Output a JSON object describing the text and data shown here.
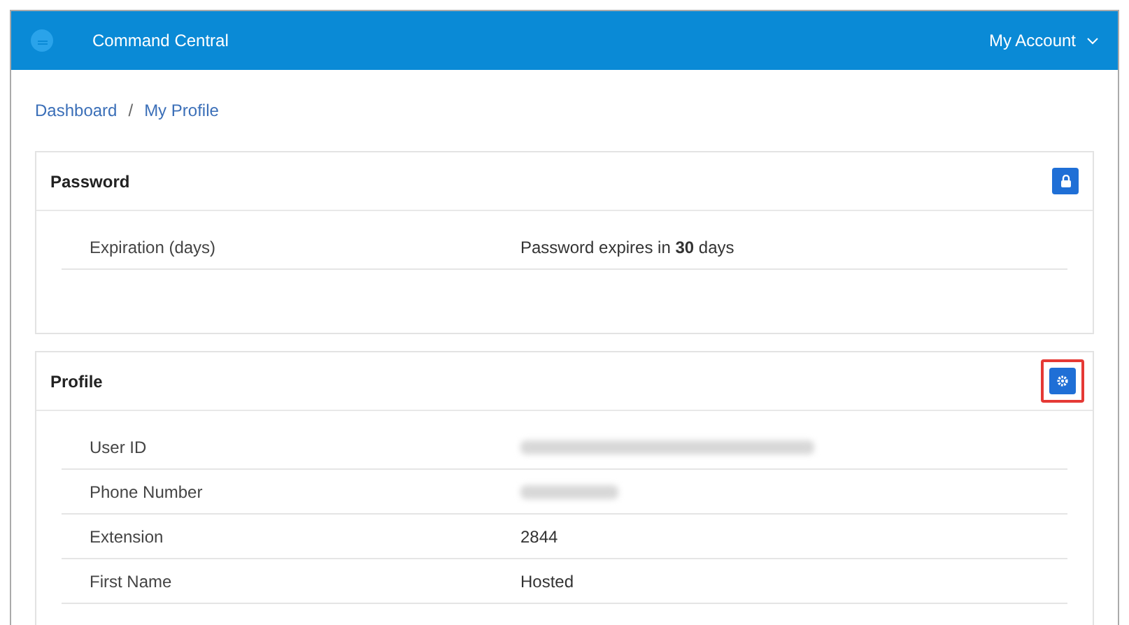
{
  "header": {
    "title": "Command Central",
    "account_menu": "My Account"
  },
  "breadcrumb": {
    "separator": "/",
    "items": [
      "Dashboard",
      "My Profile"
    ]
  },
  "password": {
    "title": "Password",
    "rows": [
      {
        "label": "Expiration (days)",
        "kind": "text",
        "value": "Password expires in **30** days"
      }
    ]
  },
  "profile": {
    "title": "Profile",
    "settings_highlighted": true,
    "rows": [
      {
        "label": "User ID",
        "kind": "redacted"
      },
      {
        "label": "Phone Number",
        "kind": "redacted"
      },
      {
        "label": "Extension",
        "kind": "text",
        "value": "2844"
      },
      {
        "label": "First Name",
        "kind": "text",
        "value": "Hosted"
      }
    ]
  }
}
